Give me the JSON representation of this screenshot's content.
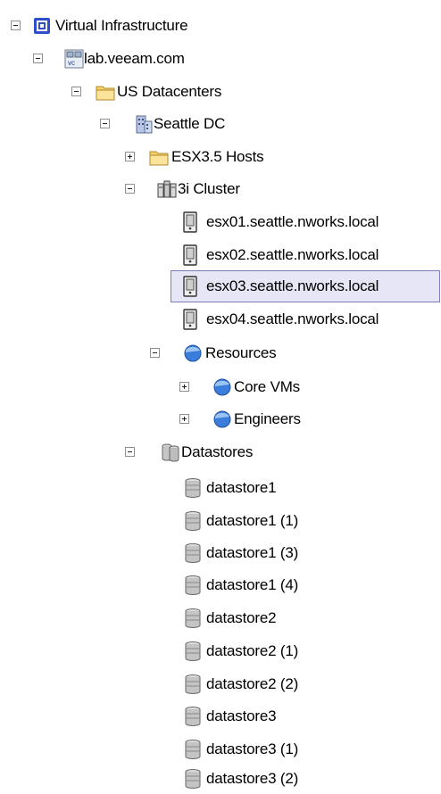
{
  "tree": {
    "root": "Virtual Infrastructure",
    "vcenter": "lab.veeam.com",
    "datacenter_folder": "US Datacenters",
    "datacenter": "Seattle DC",
    "hosts_folder": "ESX3.5 Hosts",
    "cluster": "3i Cluster",
    "hosts": [
      "esx01.seattle.nworks.local",
      "esx02.seattle.nworks.local",
      "esx03.seattle.nworks.local",
      "esx04.seattle.nworks.local"
    ],
    "resources": "Resources",
    "resource_pools": [
      "Core VMs",
      "Engineers"
    ],
    "datastores_folder": "Datastores",
    "datastores": [
      "datastore1",
      "datastore1 (1)",
      "datastore1 (3)",
      "datastore1 (4)",
      "datastore2",
      "datastore2 (1)",
      "datastore2 (2)",
      "datastore3",
      "datastore3 (1)",
      "datastore3 (2)"
    ]
  },
  "selected_item": "esx03.seattle.nworks.local",
  "colors": {
    "selection_border": "#7b7bb8",
    "selection_fill": "#e6e6f6",
    "folder": "#f6d26b",
    "resource_pool": "#3b7ddb",
    "datastore": "#b9b9b9"
  },
  "icons": {
    "root": "virtual-infrastructure-icon",
    "vcenter": "vcenter-icon",
    "folder": "folder-icon",
    "datacenter": "datacenter-icon",
    "cluster": "cluster-icon",
    "host": "host-server-icon",
    "resource_pool": "resource-pool-icon",
    "datastores_folder": "datastores-icon",
    "datastore": "datastore-icon"
  }
}
